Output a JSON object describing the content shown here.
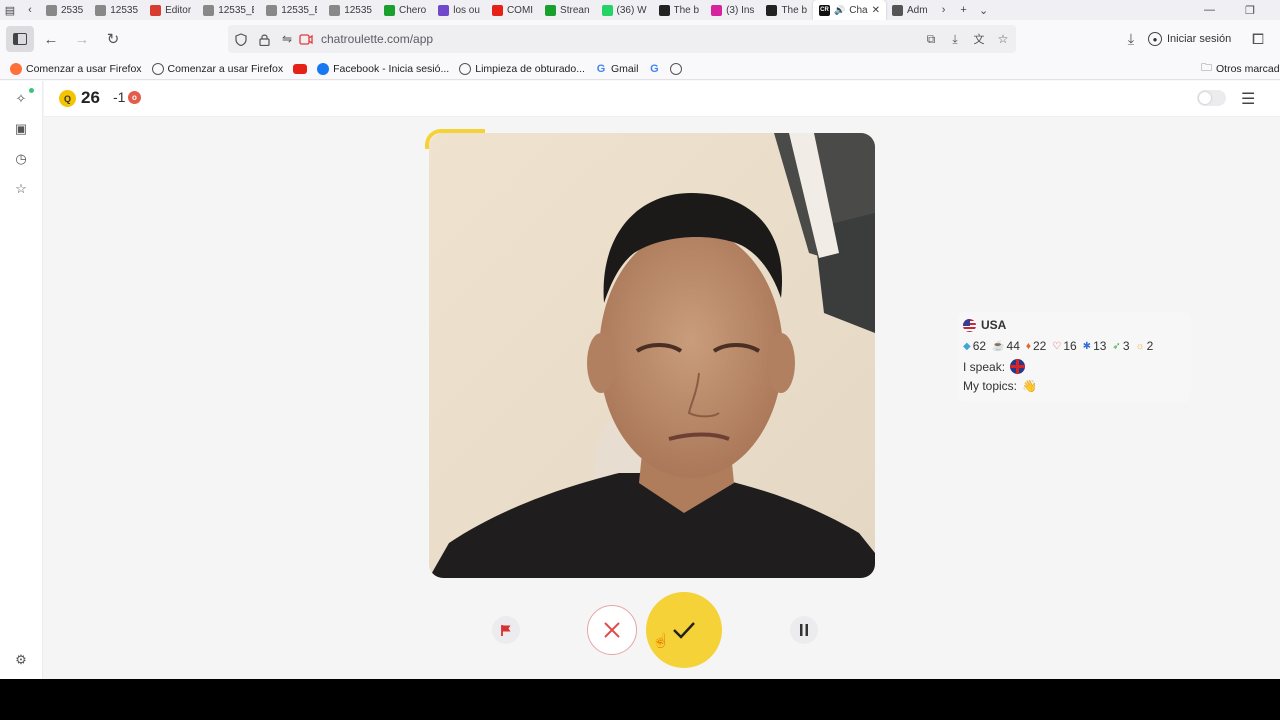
{
  "tabs": [
    {
      "label": "2535",
      "color": "#888"
    },
    {
      "label": "12535",
      "color": "#888"
    },
    {
      "label": "Editor",
      "color": "#d83b2f"
    },
    {
      "label": "12535_Bas",
      "color": "#888"
    },
    {
      "label": "12535_Bas",
      "color": "#888"
    },
    {
      "label": "12535",
      "color": "#888"
    },
    {
      "label": "Chero",
      "color": "#1aa12d"
    },
    {
      "label": "los ou",
      "color": "#6f49c9"
    },
    {
      "label": "COMI",
      "color": "#e62117"
    },
    {
      "label": "Strean",
      "color": "#1aa12d"
    },
    {
      "label": "(36) W",
      "color": "#25d366"
    },
    {
      "label": "The b",
      "color": "#222"
    },
    {
      "label": "(3) Ins",
      "color": "#d6249f"
    },
    {
      "label": "The b",
      "color": "#222"
    },
    {
      "label": "Cha",
      "color": "#111",
      "active": true,
      "badge": "CR"
    },
    {
      "label": "Adm",
      "color": "#555"
    }
  ],
  "nav": {
    "url": "chatroulette.com/app",
    "signin_label": "Iniciar sesión"
  },
  "bookmarks": [
    {
      "label": "Comenzar a usar Firefox",
      "icon": "firefox-icon",
      "color": "#ff7139"
    },
    {
      "label": "Comenzar a usar Firefox",
      "icon": "globe-icon",
      "color": "#555"
    },
    {
      "label": "",
      "icon": "youtube-icon",
      "color": "#e62117"
    },
    {
      "label": "Facebook - Inicia sesió...",
      "icon": "facebook-icon",
      "color": "#1877f2"
    },
    {
      "label": "Limpieza de obturado...",
      "icon": "globe-icon",
      "color": "#555"
    },
    {
      "label": "Gmail",
      "icon": "google-icon",
      "color": "#4285f4"
    },
    {
      "label": "",
      "icon": "google-icon",
      "color": "#4285f4"
    },
    {
      "label": "",
      "icon": "globe-icon",
      "color": "#555"
    }
  ],
  "other_bookmarks_label": "Otros marcad",
  "topbar": {
    "coin_letter": "Q",
    "balance": "26",
    "delta": "-1"
  },
  "partner": {
    "country": "USA",
    "stats": [
      {
        "value": "62",
        "icon": "diamond-icon",
        "color": "#3fa7d6"
      },
      {
        "value": "44",
        "icon": "cup-icon",
        "color": "#e0662b"
      },
      {
        "value": "22",
        "icon": "tag-icon",
        "color": "#e0662b"
      },
      {
        "value": "16",
        "icon": "heart-icon",
        "color": "#e23b3b"
      },
      {
        "value": "13",
        "icon": "star-icon",
        "color": "#3a6ed8"
      },
      {
        "value": "3",
        "icon": "rocket-icon",
        "color": "#3fae4a"
      },
      {
        "value": "2",
        "icon": "sun-icon",
        "color": "#f2b233"
      }
    ],
    "speak_label": "I speak:",
    "topics_label": "My topics:",
    "topics_emoji": "👋"
  },
  "colors": {
    "accent_yellow": "#f5d237",
    "reject_red": "#e14b4b",
    "flag_red": "#e23b3b"
  }
}
